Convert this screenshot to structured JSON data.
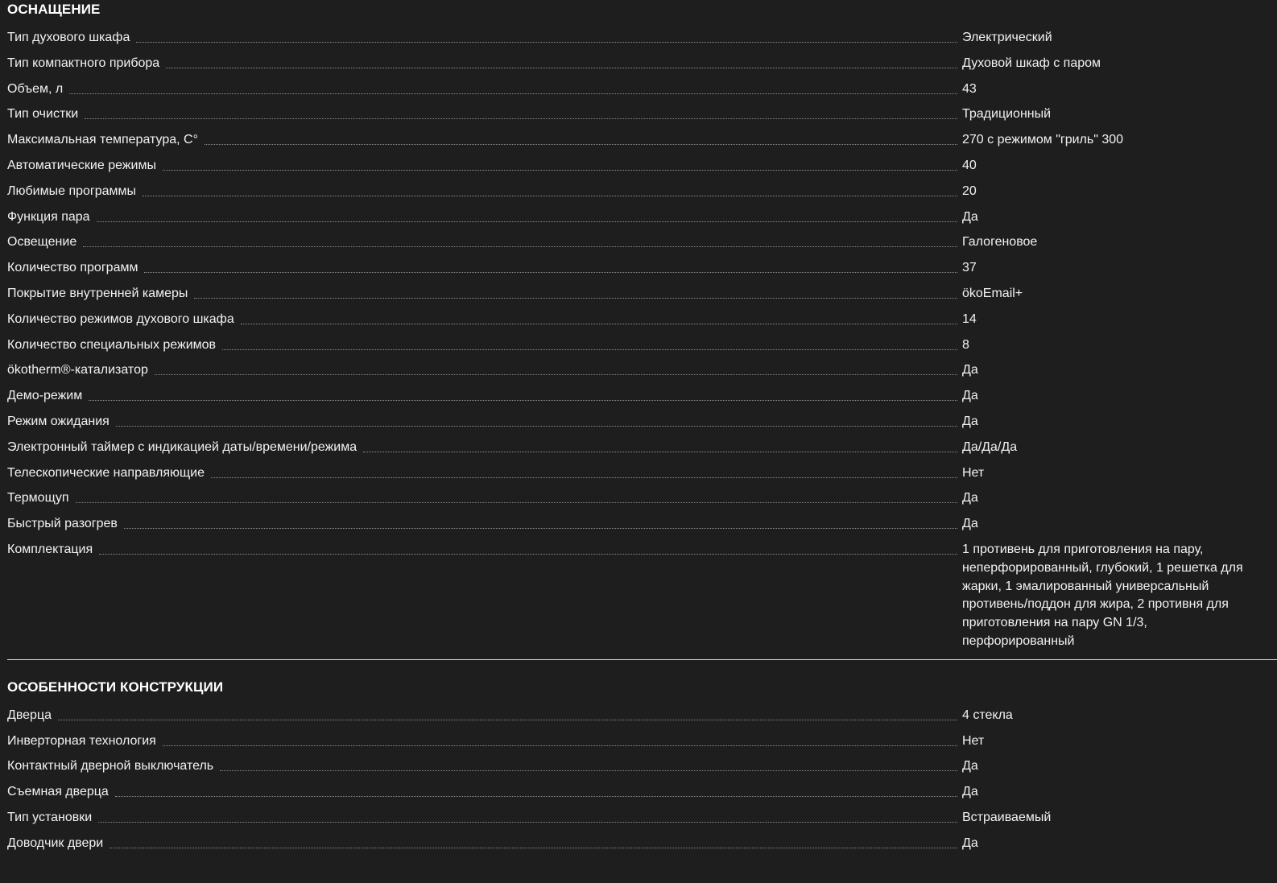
{
  "sections": [
    {
      "title": "ОСНАЩЕНИЕ",
      "rows": [
        {
          "label": "Тип духового шкафа",
          "value": "Электрический"
        },
        {
          "label": "Тип компактного прибора",
          "value": "Духовой шкаф с паром"
        },
        {
          "label": "Объем, л",
          "value": "43"
        },
        {
          "label": "Тип очистки",
          "value": "Традиционный"
        },
        {
          "label": "Максимальная температура, С°",
          "value": "270 с режимом \"гриль\" 300"
        },
        {
          "label": "Автоматические режимы",
          "value": "40"
        },
        {
          "label": "Любимые программы",
          "value": "20"
        },
        {
          "label": "Функция пара",
          "value": "Да"
        },
        {
          "label": "Освещение",
          "value": "Галогеновое"
        },
        {
          "label": "Количество программ",
          "value": "37"
        },
        {
          "label": "Покрытие внутренней камеры",
          "value": "ökoEmail+"
        },
        {
          "label": "Количество режимов духового шкафа",
          "value": "14"
        },
        {
          "label": "Количество специальных режимов",
          "value": "8"
        },
        {
          "label": "ökotherm®-катализатор",
          "value": "Да"
        },
        {
          "label": "Демо-режим",
          "value": "Да"
        },
        {
          "label": "Режим ожидания",
          "value": "Да"
        },
        {
          "label": "Электронный таймер с индикацией даты/времени/режима",
          "value": "Да/Да/Да"
        },
        {
          "label": "Телескопические направляющие",
          "value": "Нет"
        },
        {
          "label": "Термощуп",
          "value": "Да"
        },
        {
          "label": "Быстрый разогрев",
          "value": "Да"
        },
        {
          "label": "Комплектация",
          "value": "1 противень для приготовления на пару, неперфорированный, глубокий, 1 решетка для жарки, 1 эмалированный универсальный противень/поддон для жира, 2 противня для приготовления на пару GN 1/3, перфорированный"
        }
      ]
    },
    {
      "title": "ОСОБЕННОСТИ КОНСТРУКЦИИ",
      "rows": [
        {
          "label": "Дверца",
          "value": "4 стекла"
        },
        {
          "label": "Инверторная технология",
          "value": "Нет"
        },
        {
          "label": "Контактный дверной выключатель",
          "value": "Да"
        },
        {
          "label": "Съемная дверца",
          "value": "Да"
        },
        {
          "label": "Тип установки",
          "value": "Встраиваемый"
        },
        {
          "label": "Доводчик двери",
          "value": "Да"
        }
      ]
    }
  ]
}
